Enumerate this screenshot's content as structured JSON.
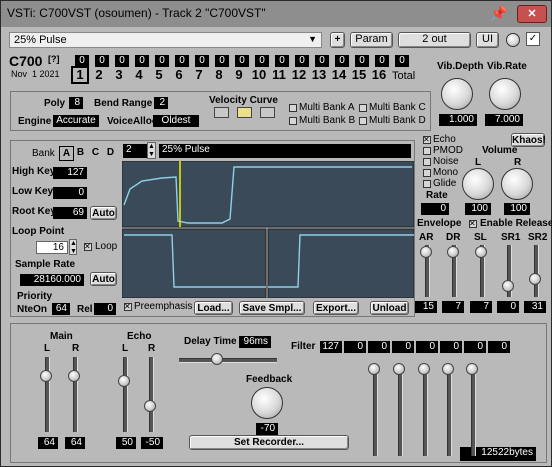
{
  "window": {
    "title": "VSTi: C700VST (osoumen) - Track 2 \"C700VST\""
  },
  "toolbar": {
    "preset": "25% Pulse",
    "plus_label": "+",
    "param_label": "Param",
    "output_label": "2 out",
    "ui_label": "UI"
  },
  "header": {
    "logo": "C700",
    "help": "[?]",
    "date": "Nov  1 2021",
    "channel_values": [
      "0",
      "0",
      "0",
      "0",
      "0",
      "0",
      "0",
      "0",
      "0",
      "0",
      "0",
      "0",
      "0",
      "0",
      "0",
      "0",
      "0"
    ],
    "channels": [
      "1",
      "2",
      "3",
      "4",
      "5",
      "6",
      "7",
      "8",
      "9",
      "10",
      "11",
      "12",
      "13",
      "14",
      "15",
      "16"
    ],
    "total_label": "Total"
  },
  "vibrato": {
    "depth_label": "Vib.Depth",
    "depth_value": "1.000",
    "rate_label": "Vib.Rate",
    "rate_value": "7.000"
  },
  "engine": {
    "poly_label": "Poly",
    "poly_value": "8",
    "bend_label": "Bend Range",
    "bend_value": "2",
    "engine_label": "Engine",
    "engine_value": "Accurate",
    "voice_label": "VoiceAlloc",
    "voice_value": "Oldest",
    "velocity_label": "Velocity Curve",
    "multibank": [
      "Multi Bank A",
      "Multi Bank B",
      "Multi Bank C",
      "Multi Bank D"
    ]
  },
  "program": {
    "bank_label": "Bank",
    "banks": [
      "A",
      "B",
      "C",
      "D"
    ],
    "number": "2",
    "name": "25% Pulse",
    "high_key_label": "High Key",
    "high_key": "127",
    "low_key_label": "Low Key",
    "low_key": "0",
    "root_key_label": "Root Key",
    "root_key": "69",
    "auto_label": "Auto",
    "loop_point_label": "Loop Point",
    "loop_point": "16",
    "loop_label": "Loop",
    "sample_rate_label": "Sample Rate",
    "sample_rate": "28160.000",
    "priority_label": "Priority",
    "nteon_label": "NteOn",
    "nteon": "64",
    "rel_label": "Rel",
    "rel": "0",
    "preemphasis_label": "Preemphasis",
    "load_label": "Load...",
    "save_label": "Save Smpl...",
    "export_label": "Export...",
    "unload_label": "Unload"
  },
  "effects": {
    "khaos_label": "Khaos!",
    "echo_label": "Echo",
    "pmod_label": "PMOD",
    "noise_label": "Noise",
    "mono_label": "Mono",
    "glide_label": "Glide",
    "rate_label": "Rate",
    "rate_value": "0",
    "volume_label": "Volume",
    "l_label": "L",
    "r_label": "R",
    "vol_l": "100",
    "vol_r": "100",
    "envelope_label": "Envelope",
    "enable_release_label": "Enable Release",
    "env_labels": [
      "AR",
      "DR",
      "SL",
      "SR1",
      "SR2"
    ],
    "env_values": [
      "15",
      "7",
      "7",
      "0",
      "31"
    ]
  },
  "mixer": {
    "main_label": "Main",
    "echo_label": "Echo",
    "main_l": "64",
    "main_r": "64",
    "echo_l": "50",
    "echo_r": "-50",
    "delay_label": "Delay Time",
    "delay_value": "96ms",
    "feedback_label": "Feedback",
    "feedback_value": "-70",
    "recorder_label": "Set Recorder...",
    "filter_label": "Filter",
    "filter_values": [
      "127",
      "0",
      "0",
      "0",
      "0",
      "0",
      "0",
      "0"
    ],
    "size": "12522bytes"
  },
  "colors": {
    "lcd": "#000000",
    "waveform": "#8fd0e8",
    "waveform_bg": "#3a4a58",
    "cursor": "#e6e600"
  }
}
